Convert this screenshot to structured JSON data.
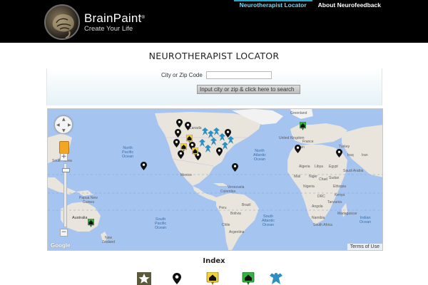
{
  "header": {
    "logo_name": "BrainPaint",
    "logo_reg": "®",
    "logo_tagline": "Create Your Life",
    "nav": [
      {
        "label": "Neurotherapist Locator",
        "active": true
      },
      {
        "label": "About Neurofeedback",
        "active": false
      }
    ]
  },
  "page_title": "NEUROTHERAPIST LOCATOR",
  "search": {
    "label": "City or Zip Code",
    "value": "",
    "placeholder": "",
    "button_label": "Input city or zip & click here to search"
  },
  "map": {
    "terms_label": "Terms of Use",
    "google_label": "Google",
    "labels": {
      "canada": "Canada",
      "north_pacific": "North\nPacific\nOcean",
      "north_atlantic": "North\nAtlantic\nOcean",
      "south_pacific": "South\nPacific\nOcean",
      "south_atlantic": "South\nAtlantic\nOcean",
      "indian_ocean": "Indian\nOcean",
      "south_korea": "South Korea",
      "papua": "Papua New\nGuinea",
      "australia": "Australia",
      "new_zealand": "New\nZealand",
      "mexico": "Mexico",
      "venezuela": "Venezuela",
      "colombia": "Colombia",
      "peru": "Peru",
      "brazil": "Brazil",
      "bolivia": "Bolivia",
      "chile": "Chile",
      "argentina": "Argentina",
      "france": "France",
      "spain": "Spain",
      "algeria": "Algeria",
      "libya": "Libya",
      "egypt": "Egypt",
      "mali": "Mali",
      "niger": "Niger",
      "chad": "Chad",
      "sudan": "Sudan",
      "saudi_arabia": "Saudi Arabia",
      "iraq": "Iraq",
      "nigeria": "Nigeria",
      "ethiopia": "Ethiopia",
      "kenya": "Kenya",
      "drc": "DRC",
      "tanzania": "Tanzania",
      "angola": "Angola",
      "namibia": "Namibia",
      "south_africa": "South Africa",
      "madagascar": "Madagascar",
      "turkey": "Turkey",
      "iran": "Iran",
      "united_kingdom": "United Kingdom",
      "greenland": "Greenland"
    }
  },
  "index": {
    "title": "Index",
    "icons": [
      {
        "icon": "star-pin-icon",
        "color": "#5a5a3a"
      },
      {
        "icon": "black-pin-icon",
        "color": "#111111"
      },
      {
        "icon": "yellow-home-pin-icon",
        "color": "#f2d23a"
      },
      {
        "icon": "green-home-pin-icon",
        "color": "#36b23f"
      },
      {
        "icon": "blue-angel-icon",
        "color": "#2e8fc0"
      }
    ]
  },
  "colors": {
    "header_bg": "#000000",
    "nav_active": "#7fd3e8",
    "water": "#a5c4f0",
    "land": "#e9e5dc"
  }
}
